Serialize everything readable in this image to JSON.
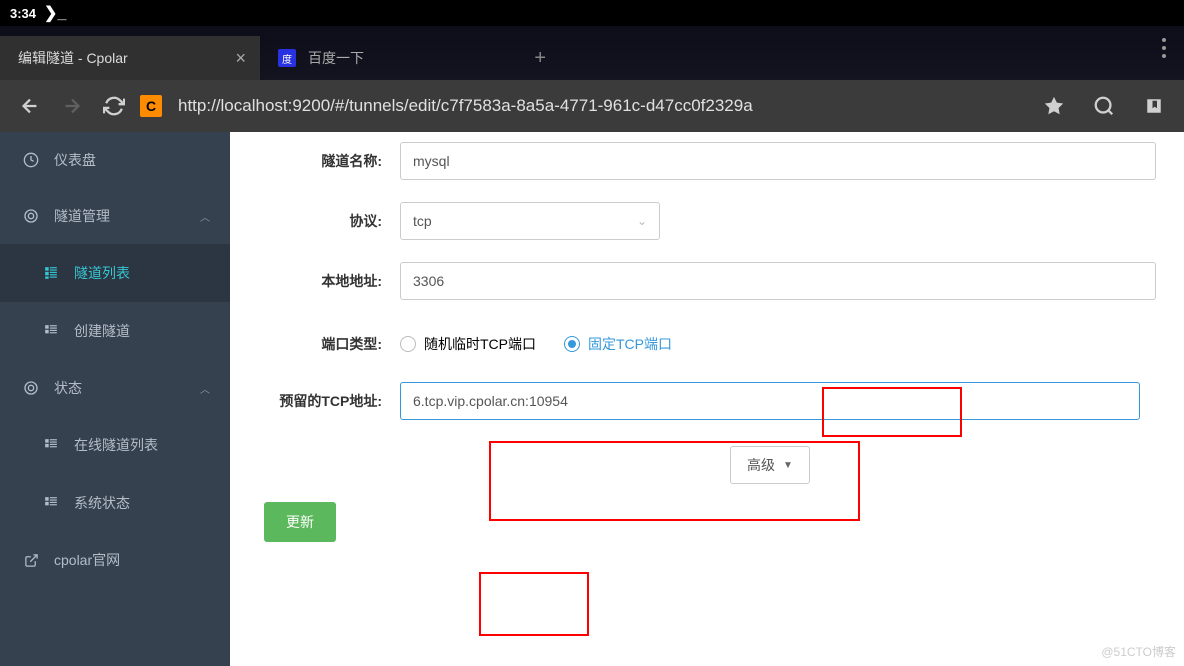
{
  "status": {
    "time": "3:34",
    "prompt": "❯_"
  },
  "tabs": {
    "active": {
      "title": "编辑隧道 - Cpolar"
    },
    "inactive": {
      "title": "百度一下"
    }
  },
  "url": "http://localhost:9200/#/tunnels/edit/c7f7583a-8a5a-4771-961c-d47cc0f2329a",
  "sidebar": {
    "dashboard": "仪表盘",
    "tunnel_mgmt": "隧道管理",
    "tunnel_list": "隧道列表",
    "create_tunnel": "创建隧道",
    "status": "状态",
    "online_tunnels": "在线隧道列表",
    "system_status": "系统状态",
    "official": "cpolar官网"
  },
  "form": {
    "name_label": "隧道名称:",
    "name_value": "mysql",
    "protocol_label": "协议:",
    "protocol_value": "tcp",
    "local_addr_label": "本地地址:",
    "local_addr_value": "3306",
    "port_type_label": "端口类型:",
    "port_random": "随机临时TCP端口",
    "port_fixed": "固定TCP端口",
    "reserved_label": "预留的TCP地址:",
    "reserved_value": "6.tcp.vip.cpolar.cn:10954",
    "advanced": "高级",
    "update": "更新"
  },
  "watermark": "@51CTO博客"
}
